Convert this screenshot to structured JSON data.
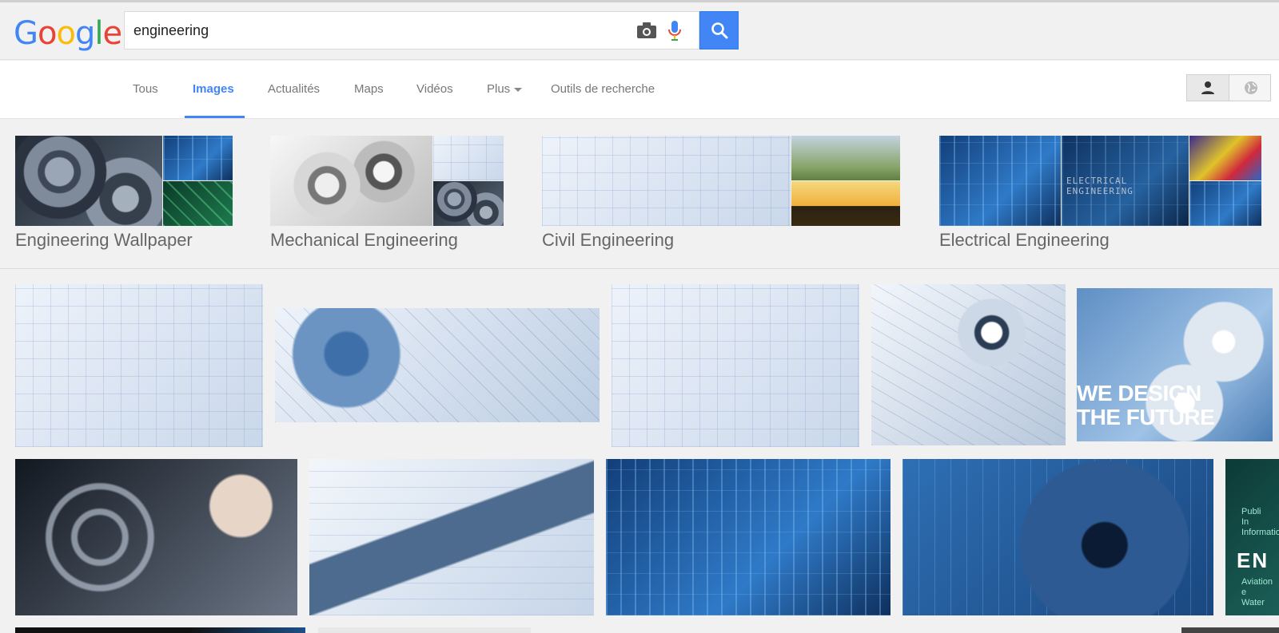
{
  "logo": {
    "letters": [
      "G",
      "o",
      "o",
      "g",
      "l",
      "e"
    ],
    "colors": [
      "#4285f4",
      "#ea4335",
      "#fbbc05",
      "#4285f4",
      "#34a853",
      "#ea4335"
    ]
  },
  "search": {
    "query": "engineering"
  },
  "icons": {
    "camera": "camera-icon",
    "mic": "microphone-icon",
    "search": "search-icon",
    "person": "person-icon",
    "globe": "globe-icon"
  },
  "tabs": [
    {
      "label": "Tous",
      "active": false
    },
    {
      "label": "Images",
      "active": true
    },
    {
      "label": "Actualités",
      "active": false
    },
    {
      "label": "Maps",
      "active": false
    },
    {
      "label": "Vidéos",
      "active": false
    },
    {
      "label": "Plus",
      "active": false,
      "dropdown": true
    },
    {
      "label": "Outils de recherche",
      "active": false
    }
  ],
  "related": [
    {
      "label": "Engineering Wallpaper"
    },
    {
      "label": "Mechanical Engineering"
    },
    {
      "label": "Civil Engineering"
    },
    {
      "label": "Electrical Engineering",
      "thumb_caption": "ELECTRICAL ENGINEERING"
    }
  ],
  "results": {
    "overlay_text_1": "WE DESIGN",
    "overlay_text_2": "THE FUTURE",
    "partial_lines": [
      "Publi",
      "In",
      "Informatio",
      "Aviation e",
      "Water"
    ],
    "partial_big": "EN"
  },
  "colors": {
    "accent": "#4285f4",
    "tab_text": "#777777",
    "label_text": "#666666",
    "background": "#f1f1f1"
  }
}
